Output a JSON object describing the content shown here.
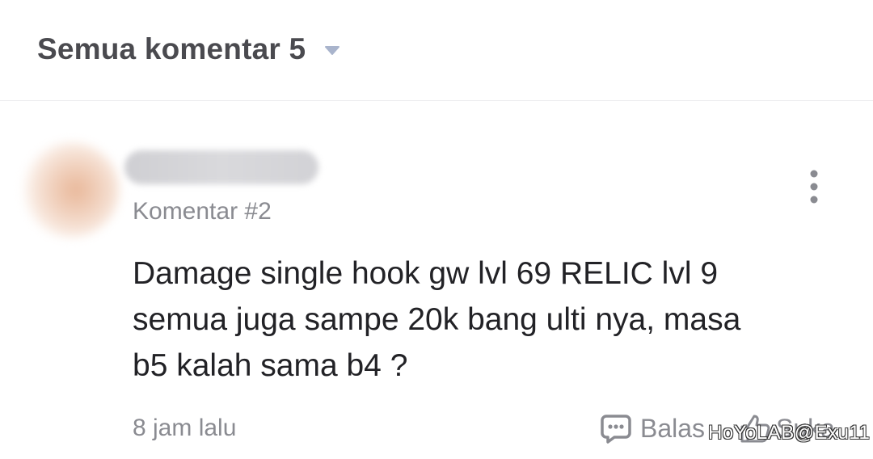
{
  "header": {
    "title": "Semua komentar 5",
    "sort_icon": "caret-down-icon"
  },
  "comment": {
    "number_label": "Komentar #2",
    "body_lines": [
      "Damage single hook gw lvl 69 RELIC lvl 9",
      "semua juga sampe 20k bang ulti nya, masa",
      "b5 kalah sama b4 ?"
    ],
    "more_icon": "more-vertical-icon",
    "timestamp": "8 jam lalu",
    "reply_label": "Balas",
    "reply_icon": "chat-bubble-icon",
    "like_label": "Suka",
    "like_icon": "thumbs-up-icon"
  },
  "watermark": "HoYoLAB@Exu11",
  "colors": {
    "text_primary": "#222226",
    "text_secondary": "#8a8b91",
    "header_text": "#4a4a4f",
    "caret": "#a9b4cc",
    "divider": "#ececef"
  }
}
